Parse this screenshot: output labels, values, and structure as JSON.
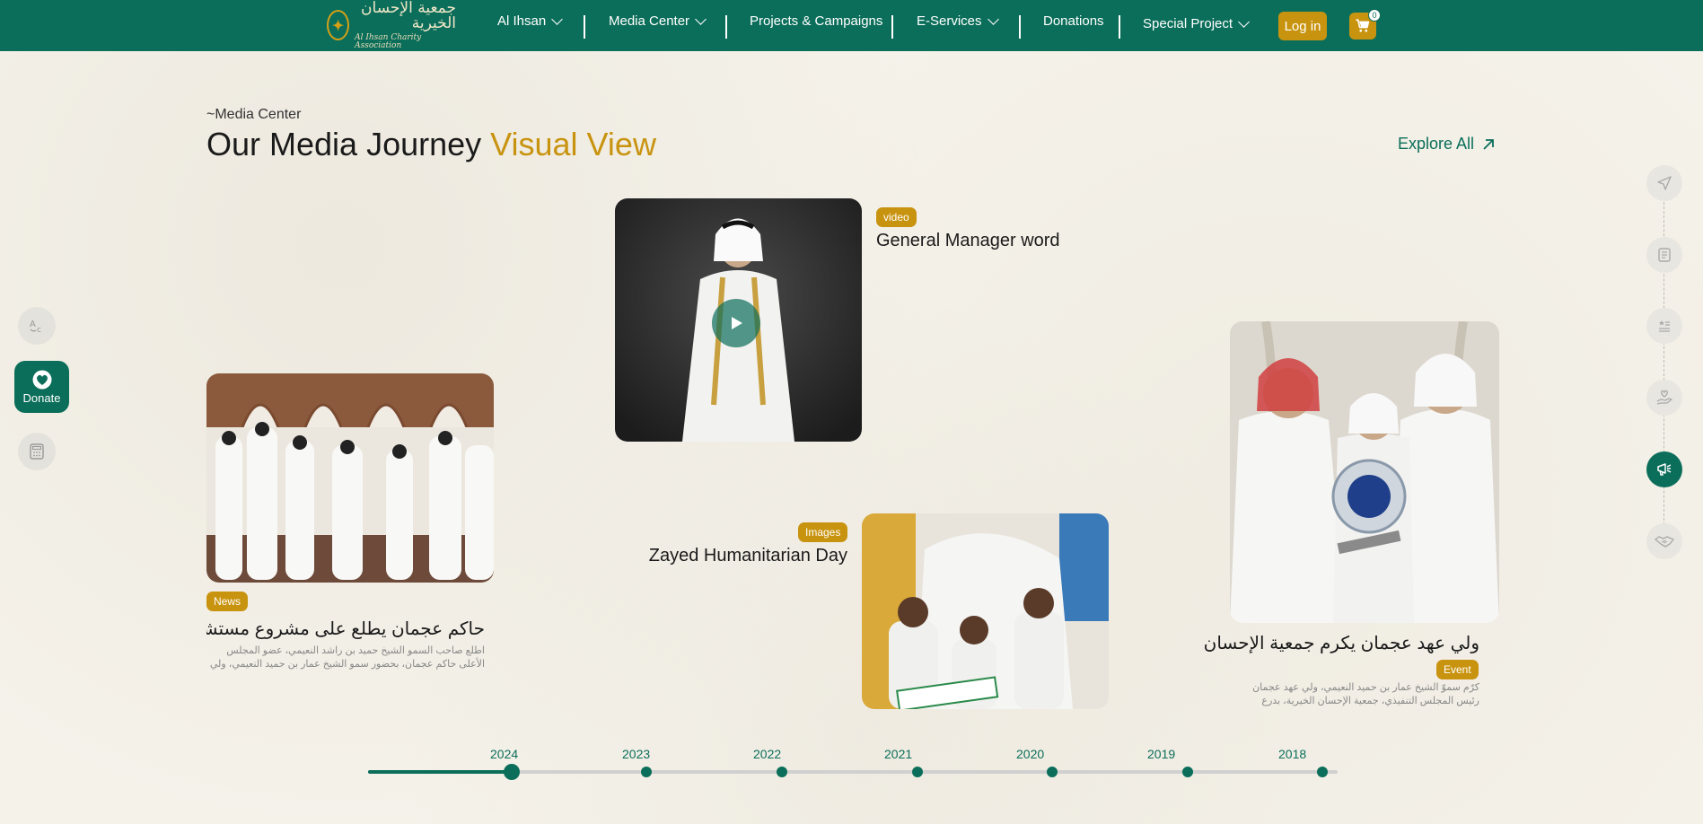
{
  "nav": {
    "logo_ar": "جمعية الإحسان الخيرية",
    "logo_en": "Al Ihsan Charity Association",
    "items": [
      {
        "label": "Al Ihsan",
        "dropdown": true
      },
      {
        "label": "Media Center",
        "dropdown": true
      },
      {
        "label": "Projects & Campaigns",
        "dropdown": false
      },
      {
        "label": "E-Services",
        "dropdown": true
      },
      {
        "label": "Donations",
        "dropdown": false
      },
      {
        "label": "Special Project",
        "dropdown": true
      }
    ],
    "login_label": "Log in",
    "cart_count": "0",
    "cart_icon": "cart-icon"
  },
  "section": {
    "eyebrow": "~Media Center",
    "title_main": "Our Media Journey",
    "title_accent": "Visual View",
    "explore_label": "Explore All"
  },
  "cards": {
    "news": {
      "badge": "News",
      "title": "حاكم عجمان يطلع على مشروع مستشفى الصفيا...",
      "desc": "اطلع صاحب السمو الشيخ حميد بن راشد النعيمي، عضو المجلس الأعلى حاكم عجمان، بحضور سمو الشيخ عمار بن حميد النعيمي، ولي عهد عجمان، رئيس..."
    },
    "video": {
      "badge": "video",
      "title": "General Manager word"
    },
    "images": {
      "badge": "Images",
      "title": "Zayed Humanitarian Day"
    },
    "event": {
      "badge": "Event",
      "title": "ولي عهد عجمان يكرم جمعية الإحسان",
      "desc": "كرّم سموّ الشيخ عمار بن حميد النعيمي، ولي عهد عجمان رئيس المجلس التنفيذي، جمعية الإحسان الخيرية، بدرع تذكارية، تسلمه سعادة الشيخ"
    }
  },
  "left_float": {
    "translate_icon": "translate-icon",
    "donate_label": "Donate",
    "calculator_icon": "calculator-icon"
  },
  "right_rail": {
    "icons": [
      "send-icon",
      "document-icon",
      "certificate-icon",
      "hand-heart-icon",
      "megaphone-icon",
      "handshake-icon"
    ],
    "active_index": 4
  },
  "timeline": {
    "years": [
      "2024",
      "2023",
      "2022",
      "2021",
      "2020",
      "2019",
      "2018"
    ],
    "active_year": "2024"
  },
  "colors": {
    "brand_green": "#0b6e5a",
    "accent_gold": "#c8930f",
    "background": "#f5f2ea"
  }
}
